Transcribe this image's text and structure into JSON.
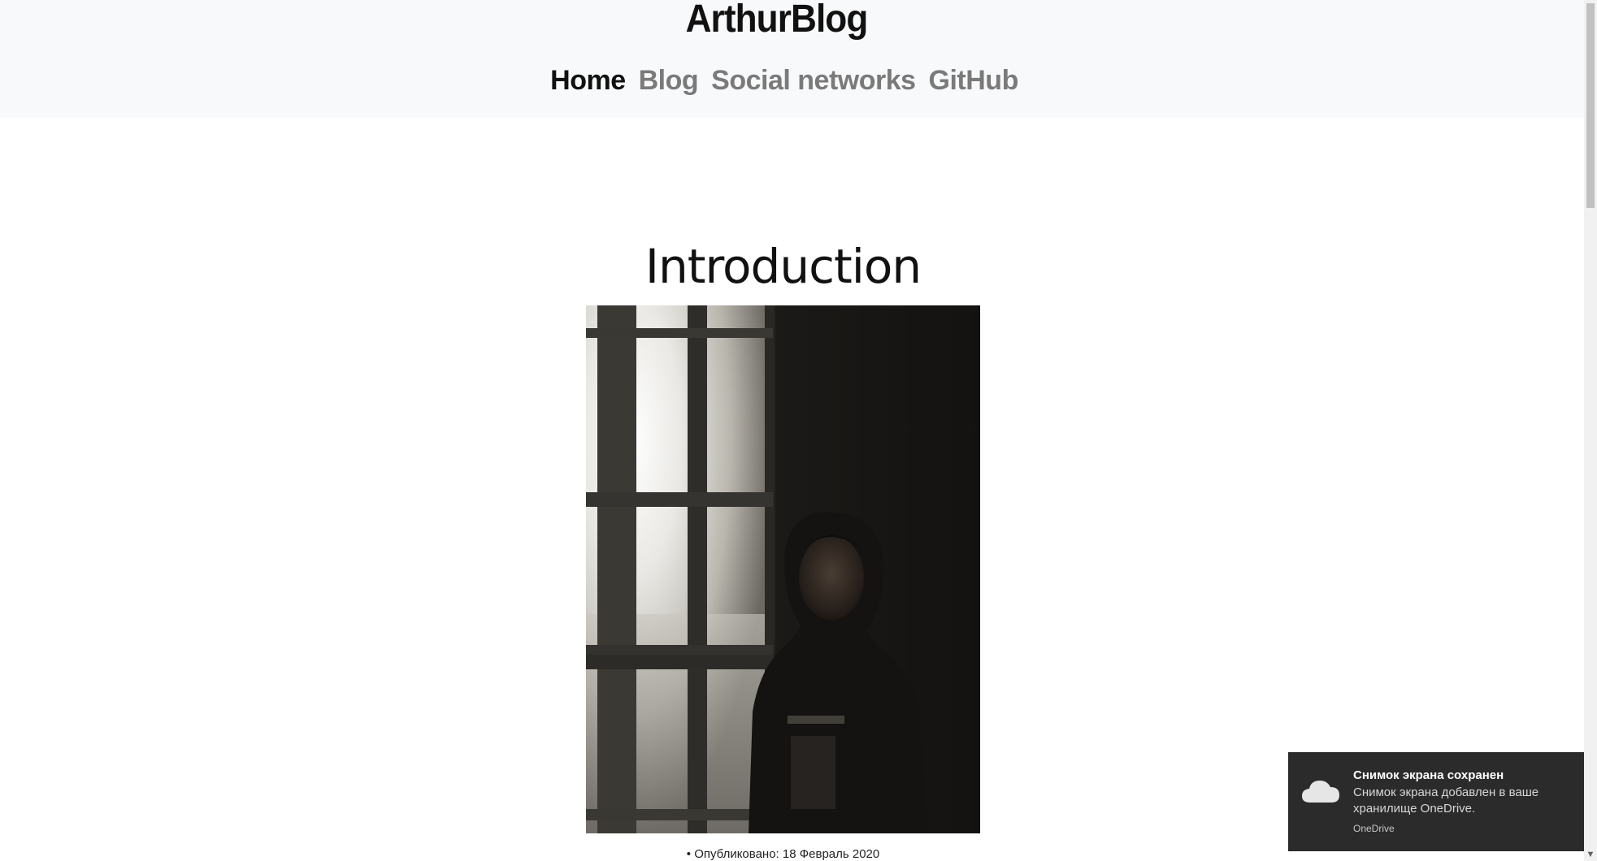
{
  "header": {
    "brand": "ArthurBlog",
    "nav": [
      {
        "label": "Home",
        "active": true
      },
      {
        "label": "Blog",
        "active": false
      },
      {
        "label": "Social networks",
        "active": false
      },
      {
        "label": "GitHub",
        "active": false
      }
    ]
  },
  "post": {
    "title": "Introduction",
    "image_alt": "Person in a dark hoodie standing beside a sunlit window",
    "meta": "Опубликовано: 18 Февраль 2020"
  },
  "toast": {
    "title": "Снимок экрана сохранен",
    "body": "Снимок экрана добавлен в ваше хранилище OneDrive.",
    "app": "OneDrive",
    "icon": "onedrive-cloud-icon"
  },
  "colors": {
    "header_bg": "#f8f9fa",
    "nav_active": "#111111",
    "nav_inactive": "#7a7a7a",
    "toast_bg": "#2b2b2b"
  }
}
